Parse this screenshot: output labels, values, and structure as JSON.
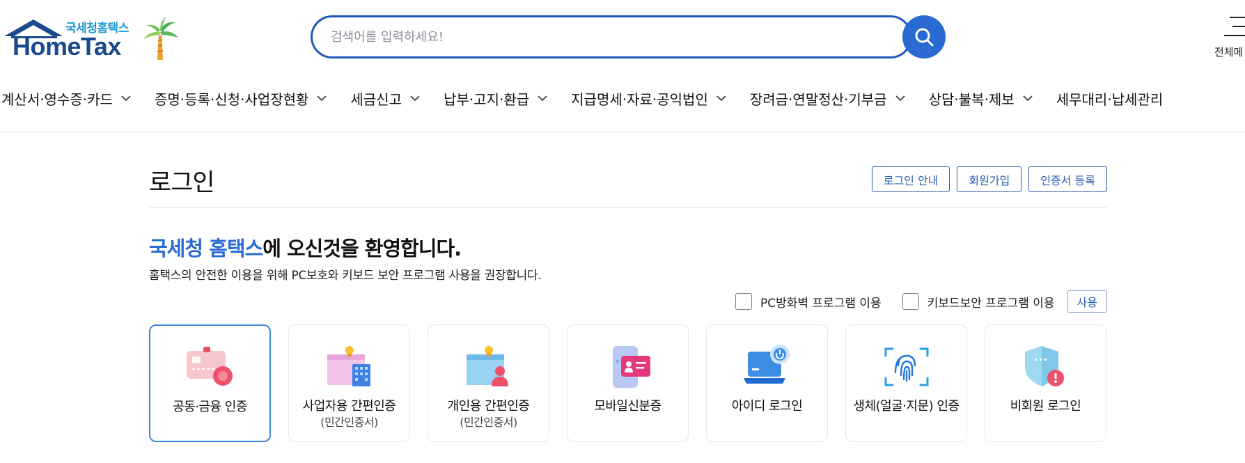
{
  "header": {
    "logo_sub": "국세청홈택스",
    "logo_main": "HomeTax",
    "search_placeholder": "검색어를 입력하세요!",
    "all_menu_label": "전체메"
  },
  "gnb": [
    {
      "label": "계산서·영수증·카드"
    },
    {
      "label": "증명·등록·신청·사업장현황"
    },
    {
      "label": "세금신고"
    },
    {
      "label": "납부·고지·환급"
    },
    {
      "label": "지급명세·자료·공익법인"
    },
    {
      "label": "장려금·연말정산·기부금"
    },
    {
      "label": "상담·불복·제보"
    },
    {
      "label": "세무대리·납세관리"
    }
  ],
  "page": {
    "title": "로그인",
    "buttons": [
      "로그인 안내",
      "회원가입",
      "인증서 등록"
    ],
    "welcome_highlight": "국세청 홈택스",
    "welcome_rest": "에 오신것을 환영합니다.",
    "welcome_sub": "홈택스의 안전한 이용을 위해 PC보호와 키보드 보안 프로그램 사용을 권장합니다.",
    "security": {
      "pc_firewall": "PC방화벽 프로그램 이용",
      "keyboard": "키보드보안 프로그램 이용",
      "use_button": "사용"
    }
  },
  "login_methods": [
    {
      "label": "공동·금융 인증",
      "sub": "",
      "icon": "certificate-card-icon",
      "active": true
    },
    {
      "label": "사업자용 간편인증",
      "sub": "(민간인증서)",
      "icon": "business-building-icon",
      "active": false
    },
    {
      "label": "개인용 간편인증",
      "sub": "(민간인증서)",
      "icon": "personal-user-icon",
      "active": false
    },
    {
      "label": "모바일신분증",
      "sub": "",
      "icon": "mobile-id-icon",
      "active": false
    },
    {
      "label": "아이디 로그인",
      "sub": "",
      "icon": "laptop-power-icon",
      "active": false
    },
    {
      "label": "생체(얼굴·지문) 인증",
      "sub": "",
      "icon": "fingerprint-icon",
      "active": false
    },
    {
      "label": "비회원 로그인",
      "sub": "",
      "icon": "guest-shield-icon",
      "active": false
    }
  ],
  "colors": {
    "brand_blue": "#2a6ad3",
    "logo_navy": "#1b4a8c",
    "active_border": "#3b88dc"
  }
}
